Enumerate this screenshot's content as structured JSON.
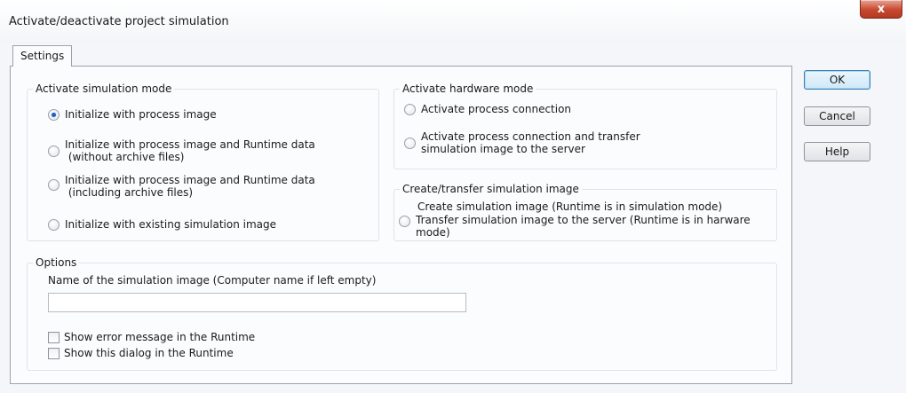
{
  "window": {
    "title": "Activate/deactivate project simulation",
    "close_label": "x"
  },
  "tabs": [
    {
      "label": "Settings"
    }
  ],
  "simulation_mode": {
    "label": "Activate simulation mode",
    "options": [
      {
        "text": "Initialize with process image",
        "selected": true
      },
      {
        "text": "Initialize with process image and Runtime data\n (without archive files)",
        "selected": false
      },
      {
        "text": "Initialize with process image and Runtime data\n (including archive files)",
        "selected": false
      },
      {
        "text": "Initialize with existing simulation image",
        "selected": false
      }
    ]
  },
  "hardware_mode": {
    "label": "Activate hardware mode",
    "options": [
      {
        "text": "Activate process connection",
        "selected": false
      },
      {
        "text": "Activate process connection and transfer\nsimulation image to the server",
        "selected": false
      }
    ]
  },
  "simulation_image": {
    "label": "Create/transfer simulation image",
    "create_text": "Create simulation image (Runtime is in simulation mode)",
    "transfer_text": "Transfer simulation image to the server (Runtime is in harware\nmode)"
  },
  "options": {
    "label": "Options",
    "name_label": "Name of the simulation image (Computer name if left empty)",
    "name_value": "",
    "show_error_label": "Show error message in the Runtime",
    "show_dialog_label": "Show this dialog in the Runtime"
  },
  "buttons": {
    "ok": "OK",
    "cancel": "Cancel",
    "help": "Help"
  }
}
